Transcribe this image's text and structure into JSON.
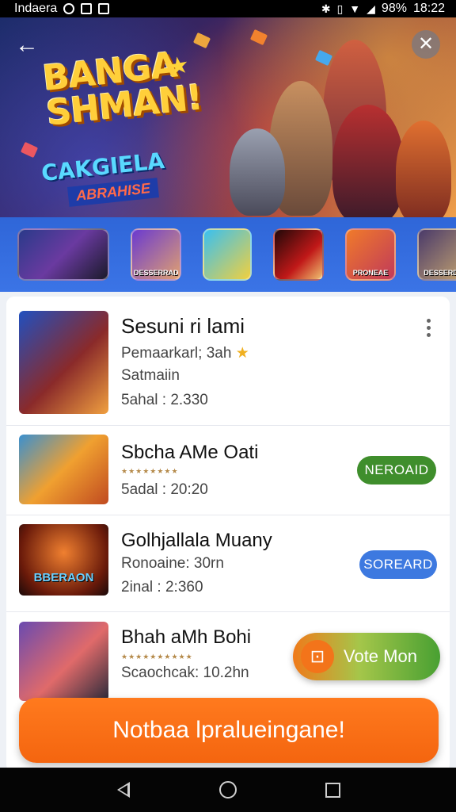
{
  "status_bar": {
    "carrier": "Indaera",
    "battery": "98%",
    "time": "18:22"
  },
  "hero": {
    "title": "BANGA SHMAN!",
    "subtitle_primary": "CAKGIELA",
    "subtitle_secondary": "ABRAHISE"
  },
  "carousel": {
    "items": [
      {
        "caption": "",
        "icon": "game-thumb"
      },
      {
        "caption": "DESSERRAD",
        "icon": "game-thumb"
      },
      {
        "caption": "",
        "icon": "game-thumb"
      },
      {
        "caption": "",
        "icon": "game-thumb"
      },
      {
        "caption": "PRONEAE",
        "icon": "game-thumb"
      },
      {
        "caption": "DESSERD",
        "icon": "game-thumb"
      }
    ]
  },
  "list": {
    "items": [
      {
        "title": "Sesuni ri lami",
        "line1": "Pemaarkarl; 3ah",
        "line2": "Satmaiin",
        "line3": "5ahal : 2.330",
        "action": ""
      },
      {
        "title": "Sbcha AMe Oati",
        "stars": "★★★★★★★★",
        "line1": "5adal : 20:20",
        "action": "NEROAID",
        "action_color": "#3f8e2c"
      },
      {
        "title": "Golhjallala Muany",
        "line1": "Ronoaine: 30rn",
        "line2": "2inal : 2:360",
        "image_caption": "BBERAON",
        "action": "SOREARD",
        "action_color": "#3d79e0"
      },
      {
        "title": "Bhah aMh Bohi",
        "stars": "★★★★★★★★★★",
        "line1": "Scaochcak: 10.2hn",
        "action": ""
      }
    ]
  },
  "vote_button": {
    "label": "Vote Mon"
  },
  "cta": {
    "label": "Notbaa lpralueingane!"
  },
  "colors": {
    "cta_orange": "#f4650f",
    "carousel_blue": "#3b74e6",
    "green_pill": "#3f8e2c",
    "blue_pill": "#3d79e0"
  }
}
